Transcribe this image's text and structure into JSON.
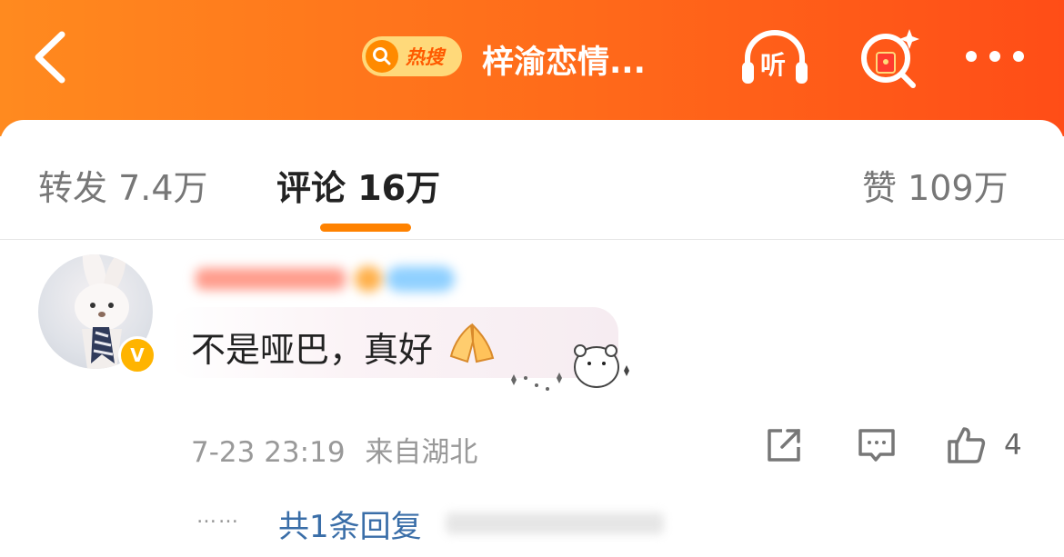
{
  "header": {
    "hot_badge_label": "热搜",
    "topic_title": "梓渝恋情...",
    "listen_label": "听",
    "accent": "#ff6a1a",
    "icons": [
      "back-arrow-icon",
      "search-icon",
      "headphones-icon",
      "sparkle-search-icon",
      "more-icon"
    ]
  },
  "tabs": {
    "repost": "转发 7.4万",
    "comments": "评论 16万",
    "likes": "赞 109万",
    "active": "comments",
    "active_color": "#ff8200"
  },
  "comment": {
    "text": "不是哑巴，真好",
    "emoji": "hands-emoji",
    "timestamp": "7-23 23:19",
    "location": "来自湖北",
    "like_count": "4",
    "replies_link": "共1条回复",
    "ellipsis": "……"
  }
}
